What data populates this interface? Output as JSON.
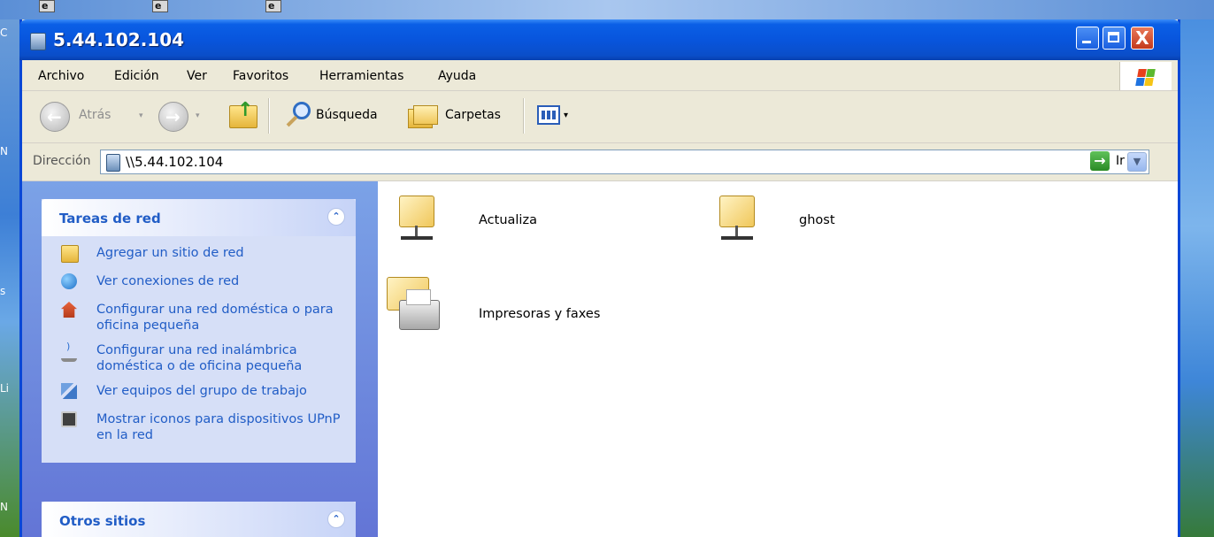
{
  "desktop": {
    "side_labels": [
      "C",
      "N",
      "s",
      "Li",
      "N"
    ]
  },
  "window": {
    "title": "5.44.102.104",
    "controls": {
      "close_glyph": "X"
    }
  },
  "menubar": {
    "items": [
      "Archivo",
      "Edición",
      "Ver",
      "Favoritos",
      "Herramientas",
      "Ayuda"
    ]
  },
  "toolbar": {
    "back_label": "Atrás",
    "search_label": "Búsqueda",
    "folders_label": "Carpetas"
  },
  "address": {
    "label": "Dirección",
    "value": "\\\\5.44.102.104",
    "go_label": "Ir"
  },
  "taskpane": {
    "network_tasks": {
      "title": "Tareas de red",
      "items": [
        {
          "label": "Agregar un sitio de red",
          "icon": "add-network-place-icon"
        },
        {
          "label": "Ver conexiones de red",
          "icon": "network-connections-icon"
        },
        {
          "label": "Configurar una red doméstica o para oficina pequeña",
          "icon": "home-network-icon"
        },
        {
          "label": "Configurar una red inalámbrica doméstica o de oficina pequeña",
          "icon": "wireless-network-icon"
        },
        {
          "label": "Ver equipos del grupo de trabajo",
          "icon": "workgroup-icon"
        },
        {
          "label": "Mostrar iconos para dispositivos UPnP en la red",
          "icon": "upnp-device-icon"
        }
      ]
    },
    "other_places": {
      "title": "Otros sitios"
    }
  },
  "content": {
    "items": [
      {
        "label": "Actualiza",
        "icon": "shared-folder-icon"
      },
      {
        "label": "ghost",
        "icon": "shared-folder-icon"
      },
      {
        "label": "Impresoras y faxes",
        "icon": "printers-faxes-icon"
      }
    ]
  }
}
